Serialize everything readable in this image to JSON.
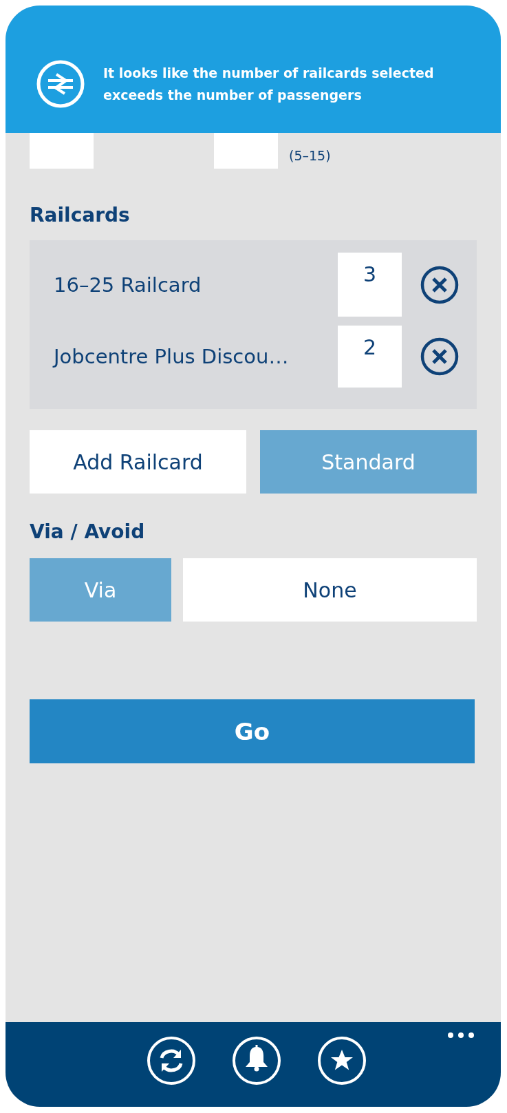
{
  "banner": {
    "message": "It looks like the number of railcards selected exceeds the number of passengers"
  },
  "passengers": {
    "children_age_range": "(5–15)"
  },
  "railcards": {
    "heading": "Railcards",
    "items": [
      {
        "name": "16–25 Railcard",
        "count": "3"
      },
      {
        "name": "Jobcentre Plus Discou…",
        "count": "2"
      }
    ],
    "buttons": [
      {
        "label": "Add Railcard",
        "kind": "plain"
      },
      {
        "label": "Standard",
        "kind": "accent"
      }
    ]
  },
  "via_avoid": {
    "heading": "Via / Avoid",
    "buttons": [
      {
        "label": "Via",
        "kind": "accent"
      },
      {
        "label": "None",
        "kind": "plain"
      }
    ]
  },
  "go_button": {
    "label": "Go"
  },
  "app_bar": {
    "buttons": [
      {
        "kind": "refresh"
      },
      {
        "kind": "bell"
      },
      {
        "kind": "star"
      }
    ]
  }
}
